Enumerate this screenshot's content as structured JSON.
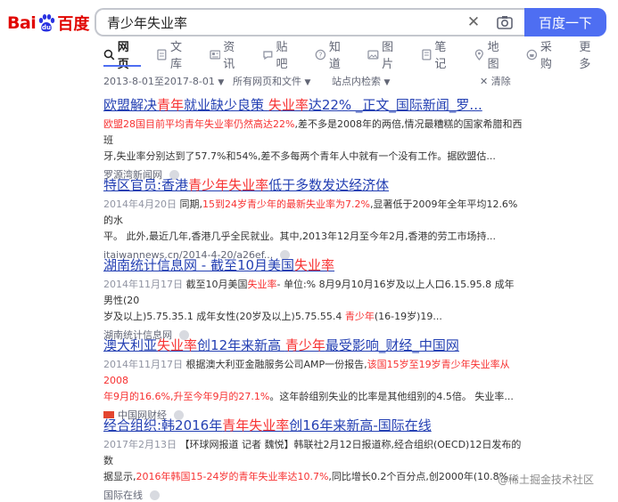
{
  "header": {
    "logo_text_1": "Bai",
    "logo_text_2": "百度",
    "query": "青少年失业率",
    "search_button": "百度一下"
  },
  "tabs": [
    {
      "label": "网页",
      "icon": "search-icon"
    },
    {
      "label": "文库",
      "icon": "document-icon"
    },
    {
      "label": "资讯",
      "icon": "news-icon"
    },
    {
      "label": "贴吧",
      "icon": "tieba-icon"
    },
    {
      "label": "知道",
      "icon": "question-icon"
    },
    {
      "label": "图片",
      "icon": "image-icon"
    },
    {
      "label": "笔记",
      "icon": "note-icon"
    },
    {
      "label": "地图",
      "icon": "map-icon"
    },
    {
      "label": "采购",
      "icon": "shopping-icon"
    },
    {
      "label": "更多",
      "icon": ""
    }
  ],
  "filters": {
    "date_range": "2013-8-01至2017-8-01",
    "type": "所有网页和文件",
    "site": "站点内检索",
    "clear": "清除"
  },
  "results": [
    {
      "title_parts": [
        "欧盟解决",
        "青年",
        "就业缺少良策 ",
        "失业率",
        "达22% _正文_国际新闻_罗..."
      ],
      "abstract_lines": [
        {
          "parts": [
            [
              "em",
              "欧盟28国目前平均青年失业率仍然高达22%"
            ],
            [
              "",
              ",差不多是2008年的两倍,情况最糟糕的国家希腊和西班"
            ]
          ]
        },
        {
          "parts": [
            [
              "",
              "牙,失业率分别达到了57.7%和54%,差不多每两个青年人中就有一个没有工作。据欧盟估..."
            ]
          ]
        }
      ],
      "source": "罗源湾新闻网"
    },
    {
      "title_parts": [
        "特区官员:香港",
        "青少年失业率",
        "低于多数发达经济体"
      ],
      "abstract_lines": [
        {
          "parts": [
            [
              "date",
              "2014年4月20日 "
            ],
            [
              "",
              "同期,"
            ],
            [
              "em",
              "15到24岁青少年的最新失业率为7.2%"
            ],
            [
              "",
              ",显著低于2009年全年平均12.6%的水"
            ]
          ]
        },
        {
          "parts": [
            [
              "",
              "平。 此外,最近几年,香港几乎全民就业。其中,2013年12月至今年2月,香港的劳工市场持..."
            ]
          ]
        }
      ],
      "source": "itaiwannews.cn/2014-4-20/a26ef..."
    },
    {
      "title_parts": [
        "湖南统计信息网 - 截至10月美国",
        "失业率"
      ],
      "abstract_lines": [
        {
          "parts": [
            [
              "date",
              "2014年11月17日 "
            ],
            [
              "",
              "截至10月美国"
            ],
            [
              "em",
              "失业率"
            ],
            [
              "",
              "- 单位:% 8月9月10月16岁及以上人口6.15.95.8 成年男性(20"
            ]
          ]
        },
        {
          "parts": [
            [
              "",
              "岁及以上)5.75.35.1 成年女性(20岁及以上)5.75.55.4 "
            ],
            [
              "em",
              "青少年"
            ],
            [
              "",
              "(16-19岁)19..."
            ]
          ]
        }
      ],
      "source": "湖南统计信息网"
    },
    {
      "title_parts": [
        "澳大利亚",
        "失业率",
        "创12年来新高 ",
        "青少年",
        "最受影响_财经_中国网"
      ],
      "abstract_lines": [
        {
          "parts": [
            [
              "date",
              "2014年11月17日 "
            ],
            [
              "",
              "根据澳大利亚金融服务公司AMP一份报告,"
            ],
            [
              "em",
              "该国15岁至19岁青少年失业率从2008"
            ]
          ]
        },
        {
          "parts": [
            [
              "em",
              "年9月的16.6%,升至今年9月的27.1%"
            ],
            [
              "",
              "。这年龄组别失业的比率是其他组别的4.5倍。 失业率..."
            ]
          ]
        }
      ],
      "source": "中国网财经"
    },
    {
      "title_parts": [
        "经合组织:韩2016年",
        "青年失业率",
        "创16年来新高-国际在线"
      ],
      "abstract_lines": [
        {
          "parts": [
            [
              "date",
              "2017年2月13日 "
            ],
            [
              "",
              "【环球网报道 记者 魏悦】韩联社2月12日报道称,经合组织(OECD)12日发布的数"
            ]
          ]
        },
        {
          "parts": [
            [
              "",
              "据显示,"
            ],
            [
              "em",
              "2016年韩国15-24岁的青年失业率达10.7%"
            ],
            [
              "",
              ",同比增长0.2个百分点,创2000年(10.8%..."
            ]
          ]
        }
      ],
      "source": "国际在线"
    }
  ],
  "watermark": "@稀土掘金技术社区"
}
